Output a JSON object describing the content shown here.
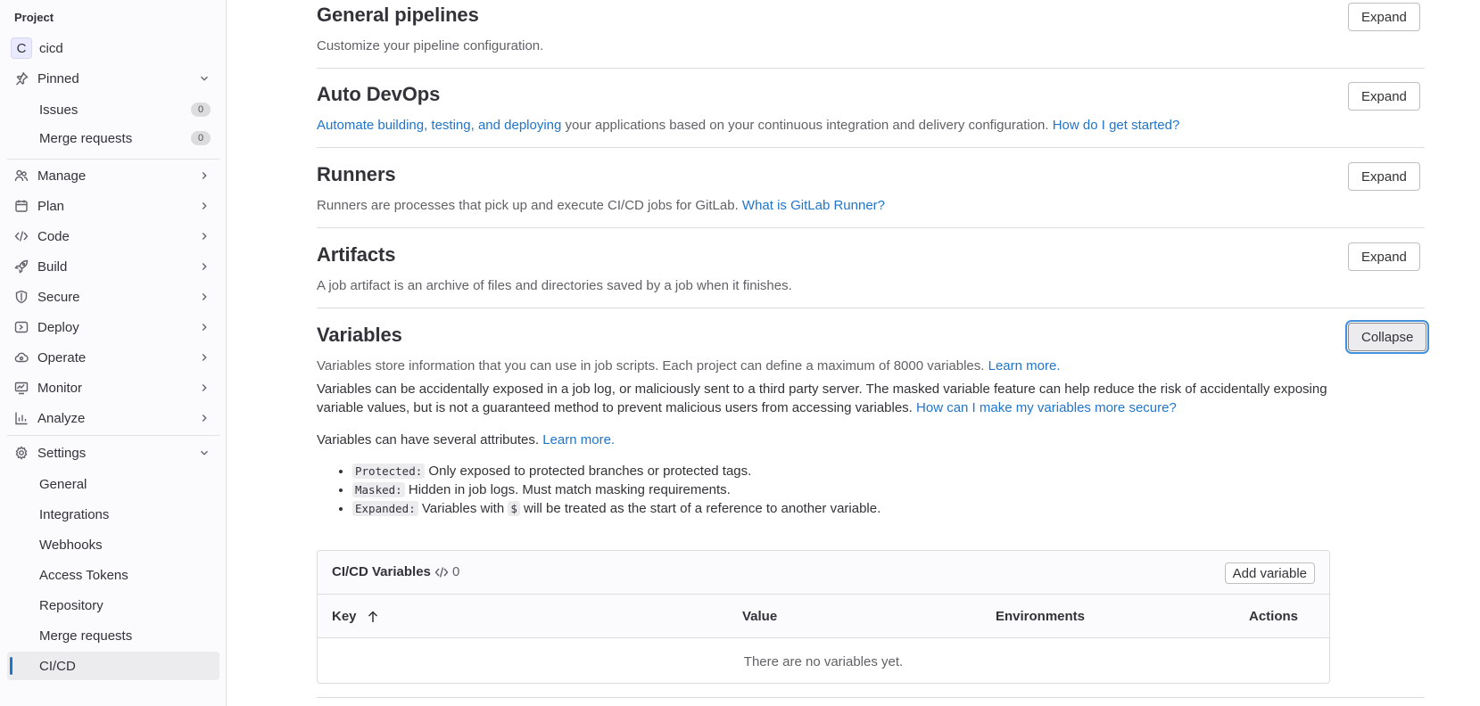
{
  "sidebar": {
    "section_title": "Project",
    "project": {
      "avatar_letter": "C",
      "name": "cicd"
    },
    "pinned": {
      "label": "Pinned",
      "items": [
        {
          "label": "Issues",
          "count": "0"
        },
        {
          "label": "Merge requests",
          "count": "0"
        }
      ]
    },
    "groups": [
      {
        "label": "Manage",
        "icon": "users-icon"
      },
      {
        "label": "Plan",
        "icon": "calendar-icon"
      },
      {
        "label": "Code",
        "icon": "code-icon"
      },
      {
        "label": "Build",
        "icon": "rocket-icon"
      },
      {
        "label": "Secure",
        "icon": "shield-icon"
      },
      {
        "label": "Deploy",
        "icon": "deploy-icon"
      },
      {
        "label": "Operate",
        "icon": "cloud-icon"
      },
      {
        "label": "Monitor",
        "icon": "monitor-icon"
      },
      {
        "label": "Analyze",
        "icon": "chart-icon"
      }
    ],
    "settings": {
      "label": "Settings",
      "items": [
        {
          "label": "General"
        },
        {
          "label": "Integrations"
        },
        {
          "label": "Webhooks"
        },
        {
          "label": "Access Tokens"
        },
        {
          "label": "Repository"
        },
        {
          "label": "Merge requests"
        },
        {
          "label": "CI/CD",
          "active": true
        }
      ]
    }
  },
  "sections": {
    "general_pipelines": {
      "title": "General pipelines",
      "description": "Customize your pipeline configuration.",
      "button": "Expand"
    },
    "auto_devops": {
      "title": "Auto DevOps",
      "link1": "Automate building, testing, and deploying",
      "text": " your applications based on your continuous integration and delivery configuration. ",
      "link2": "How do I get started?",
      "button": "Expand"
    },
    "runners": {
      "title": "Runners",
      "text": "Runners are processes that pick up and execute CI/CD jobs for GitLab. ",
      "link": "What is GitLab Runner?",
      "button": "Expand"
    },
    "artifacts": {
      "title": "Artifacts",
      "description": "A job artifact is an archive of files and directories saved by a job when it finishes.",
      "button": "Expand"
    },
    "variables": {
      "title": "Variables",
      "button": "Collapse",
      "desc_text": "Variables store information that you can use in job scripts. Each project can define a maximum of 8000 variables. ",
      "desc_link": "Learn more.",
      "warning_text": "Variables can be accidentally exposed in a job log, or maliciously sent to a third party server. The masked variable feature can help reduce the risk of accidentally exposing variable values, but is not a guaranteed method to prevent malicious users from accessing variables. ",
      "warning_link": "How can I make my variables more secure?",
      "attrs_text": "Variables can have several attributes. ",
      "attrs_link": "Learn more.",
      "attributes": [
        {
          "code": "Protected:",
          "text": " Only exposed to protected branches or protected tags."
        },
        {
          "code": "Masked:",
          "text": " Hidden in job logs. Must match masking requirements."
        },
        {
          "code": "Expanded:",
          "text_before": " Variables with ",
          "code2": "$",
          "text": " will be treated as the start of a reference to another variable."
        }
      ]
    }
  },
  "ci_variables": {
    "title": "CI/CD Variables",
    "count": "0",
    "add_button": "Add variable",
    "columns": {
      "key": "Key",
      "value": "Value",
      "environments": "Environments",
      "actions": "Actions"
    },
    "empty_text": "There are no variables yet."
  }
}
